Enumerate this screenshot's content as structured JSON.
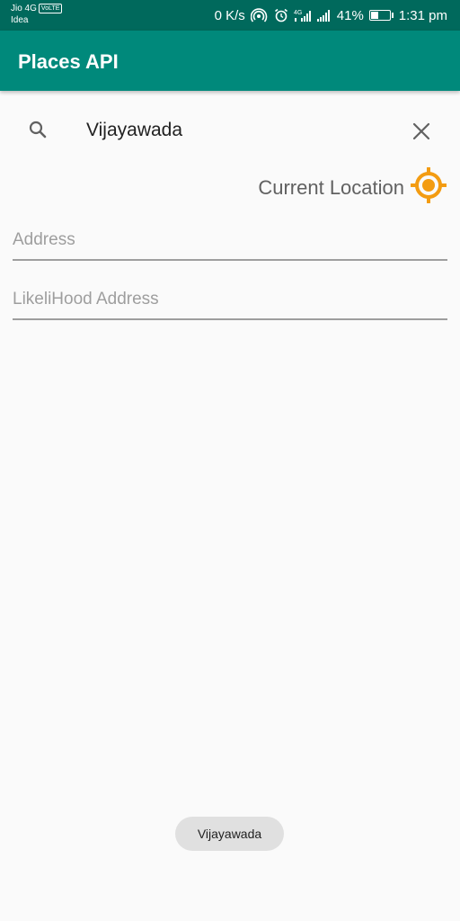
{
  "status_bar": {
    "carrier_primary": "Jio 4G",
    "volte_badge": "VoLTE",
    "carrier_secondary": "Idea",
    "data_speed": "0 K/s",
    "battery_percent": "41%",
    "battery_level": 0.41,
    "time": "1:31 pm",
    "icons": [
      "hotspot-icon",
      "alarm-icon",
      "4g-signal-icon",
      "signal-icon",
      "battery-icon"
    ]
  },
  "app_bar": {
    "title": "Places API"
  },
  "search": {
    "value": "Vijayawada",
    "search_icon": "search-icon",
    "clear_icon": "close-icon"
  },
  "current_location": {
    "label": "Current Location",
    "icon": "crosshair-icon",
    "icon_color": "#f39c12"
  },
  "fields": {
    "address_placeholder": "Address",
    "likelihood_placeholder": "LikeliHood Address"
  },
  "toast": {
    "text": "Vijayawada"
  },
  "colors": {
    "status_bar": "#00695c",
    "app_bar": "#00897b",
    "background": "#fafafa",
    "accent": "#f39c12"
  }
}
